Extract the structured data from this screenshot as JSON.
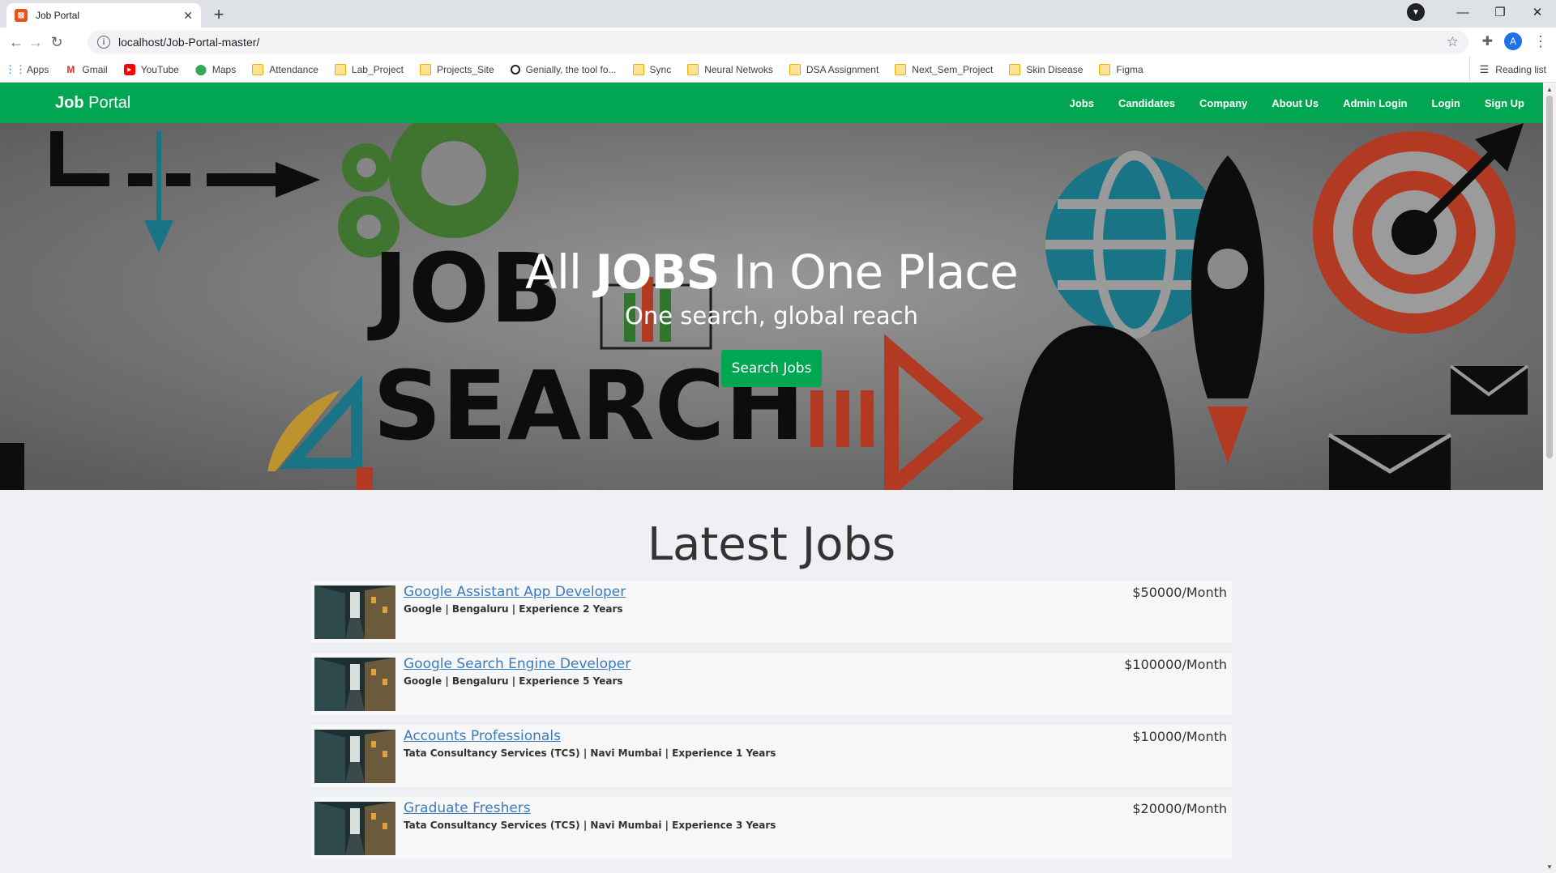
{
  "browser": {
    "tab_title": "Job Portal",
    "url": "localhost/Job-Portal-master/",
    "profile_initial": "A",
    "bookmarks": [
      {
        "label": "Apps",
        "icon": "apps-grid-icon"
      },
      {
        "label": "Gmail",
        "icon": "gmail-icon"
      },
      {
        "label": "YouTube",
        "icon": "youtube-icon"
      },
      {
        "label": "Maps",
        "icon": "maps-pin-icon"
      },
      {
        "label": "Attendance",
        "icon": "folder-icon"
      },
      {
        "label": "Lab_Project",
        "icon": "folder-icon"
      },
      {
        "label": "Projects_Site",
        "icon": "folder-icon"
      },
      {
        "label": "Genially, the tool fo...",
        "icon": "genially-icon"
      },
      {
        "label": "Sync",
        "icon": "folder-icon"
      },
      {
        "label": "Neural Netwoks",
        "icon": "folder-icon"
      },
      {
        "label": "DSA Assignment",
        "icon": "folder-icon"
      },
      {
        "label": "Next_Sem_Project",
        "icon": "folder-icon"
      },
      {
        "label": "Skin Disease",
        "icon": "folder-icon"
      },
      {
        "label": "Figma",
        "icon": "folder-icon"
      }
    ],
    "reading_list": "Reading list"
  },
  "navbar": {
    "brand_bold": "Job",
    "brand_rest": " Portal",
    "links": [
      "Jobs",
      "Candidates",
      "Company",
      "About Us",
      "Admin Login",
      "Login",
      "Sign Up"
    ],
    "color": "#00a651"
  },
  "hero": {
    "title_pre": "All ",
    "title_bold": "JOBS",
    "title_post": " In One Place",
    "subtitle": "One search, global reach",
    "button": "Search Jobs",
    "background_words": [
      "JOB",
      "SEARCH"
    ]
  },
  "section": {
    "title": "Latest Jobs"
  },
  "jobs": [
    {
      "title": "Google Assistant App Developer",
      "meta": "Google | Bengaluru | Experience 2 Years",
      "salary": "$50000/Month"
    },
    {
      "title": "Google Search Engine Developer",
      "meta": "Google | Bengaluru | Experience 5 Years",
      "salary": "$100000/Month"
    },
    {
      "title": "Accounts Professionals",
      "meta": "Tata Consultancy Services (TCS) | Navi Mumbai | Experience 1 Years",
      "salary": "$10000/Month"
    },
    {
      "title": "Graduate Freshers",
      "meta": "Tata Consultancy Services (TCS) | Navi Mumbai | Experience 3 Years",
      "salary": "$20000/Month"
    }
  ]
}
